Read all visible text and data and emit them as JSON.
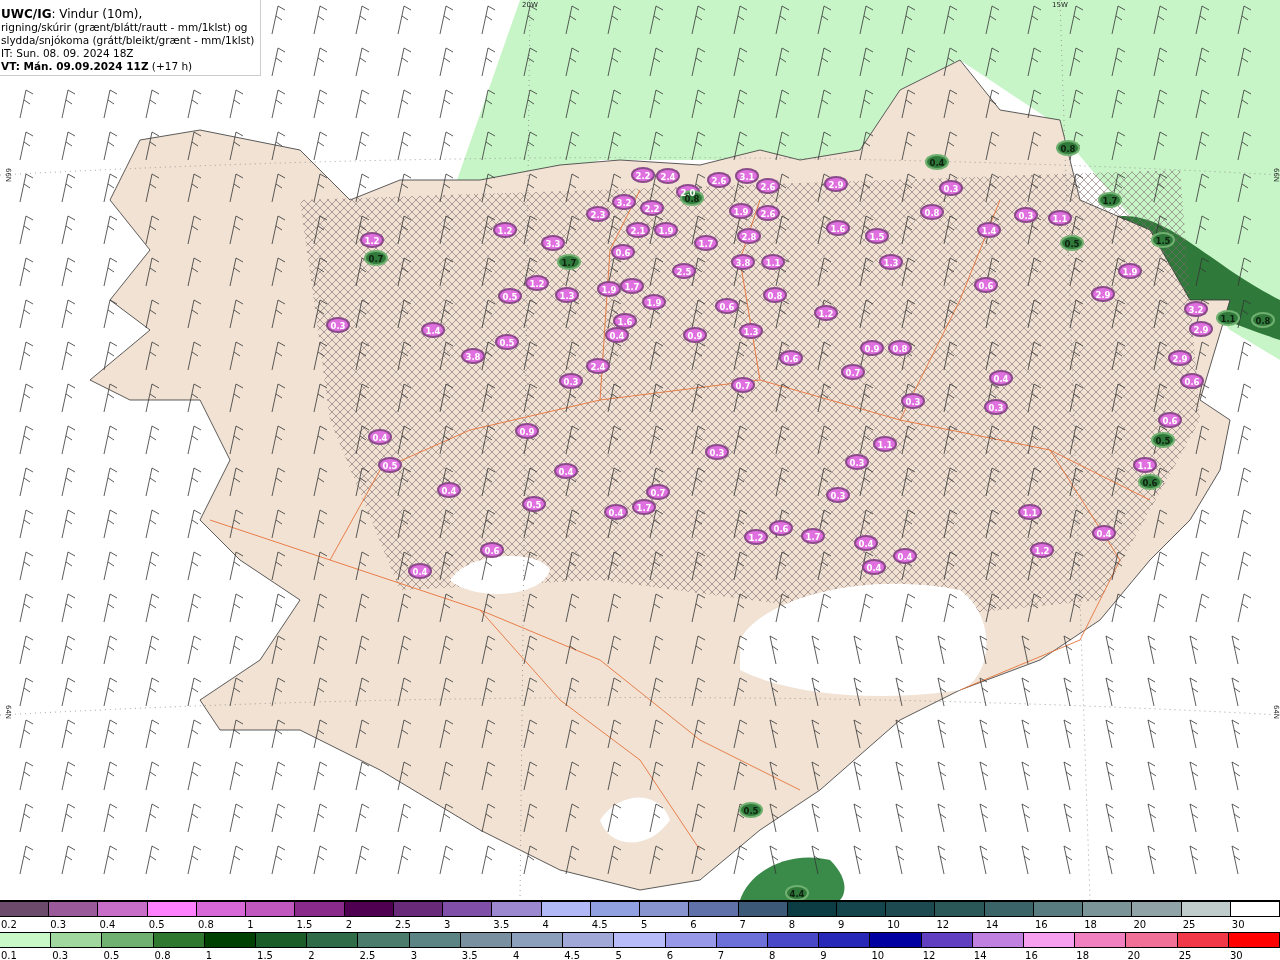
{
  "title_box": {
    "lines": [
      "**UWC/IG**: Vindur (10m),",
      "rigning/skúrir (grænt/blátt/rautt - mm/1klst) og",
      "slydda/snjókoma (grátt/bleikt/grænt - mm/1klst)",
      "IT: Sun. 08. 09. 2024 18Z",
      "**VT: Mán. 09.09.2024 11Z** (+17 h)"
    ]
  },
  "map": {
    "grid_labels": [
      "20W",
      "15W",
      "66N",
      "66N",
      "64N",
      "64N"
    ],
    "labels": [
      {
        "text": "1.2",
        "kind": "snow"
      },
      {
        "text": "0.7",
        "kind": "rain"
      },
      {
        "text": "0.3",
        "kind": "snow"
      },
      {
        "text": "1.4",
        "kind": "snow"
      },
      {
        "text": "0.5",
        "kind": "snow"
      },
      {
        "text": "3.8",
        "kind": "snow"
      },
      {
        "text": "1.2",
        "kind": "snow"
      },
      {
        "text": "3.3",
        "kind": "snow"
      },
      {
        "text": "1.7",
        "kind": "rain"
      },
      {
        "text": "1.2",
        "kind": "snow"
      },
      {
        "text": "0.5",
        "kind": "snow"
      },
      {
        "text": "1.3",
        "kind": "snow"
      },
      {
        "text": "2.4",
        "kind": "snow"
      },
      {
        "text": "0.3",
        "kind": "snow"
      },
      {
        "text": "0.4",
        "kind": "snow"
      },
      {
        "text": "1.9",
        "kind": "snow"
      },
      {
        "text": "1.7",
        "kind": "snow"
      },
      {
        "text": "1.9",
        "kind": "snow"
      },
      {
        "text": "1.6",
        "kind": "snow"
      },
      {
        "text": "2.3",
        "kind": "snow"
      },
      {
        "text": "3.2",
        "kind": "snow"
      },
      {
        "text": "2.2",
        "kind": "snow"
      },
      {
        "text": "2.4",
        "kind": "snow"
      },
      {
        "text": "2.2",
        "kind": "snow"
      },
      {
        "text": "2.0",
        "kind": "snow"
      },
      {
        "text": "0.8",
        "kind": "rain"
      },
      {
        "text": "2.1",
        "kind": "snow"
      },
      {
        "text": "1.9",
        "kind": "snow"
      },
      {
        "text": "0.6",
        "kind": "snow"
      },
      {
        "text": "1.7",
        "kind": "snow"
      },
      {
        "text": "2.5",
        "kind": "snow"
      },
      {
        "text": "2.6",
        "kind": "snow"
      },
      {
        "text": "3.1",
        "kind": "snow"
      },
      {
        "text": "2.6",
        "kind": "snow"
      },
      {
        "text": "1.9",
        "kind": "snow"
      },
      {
        "text": "2.6",
        "kind": "snow"
      },
      {
        "text": "2.8",
        "kind": "snow"
      },
      {
        "text": "3.8",
        "kind": "snow"
      },
      {
        "text": "1.1",
        "kind": "snow"
      },
      {
        "text": "0.8",
        "kind": "snow"
      },
      {
        "text": "0.6",
        "kind": "snow"
      },
      {
        "text": "0.9",
        "kind": "snow"
      },
      {
        "text": "1.3",
        "kind": "snow"
      },
      {
        "text": "0.6",
        "kind": "snow"
      },
      {
        "text": "0.7",
        "kind": "snow"
      },
      {
        "text": "2.9",
        "kind": "snow"
      },
      {
        "text": "1.6",
        "kind": "snow"
      },
      {
        "text": "1.5",
        "kind": "snow"
      },
      {
        "text": "1.3",
        "kind": "snow"
      },
      {
        "text": "1.2",
        "kind": "snow"
      },
      {
        "text": "0.7",
        "kind": "snow"
      },
      {
        "text": "0.9",
        "kind": "snow"
      },
      {
        "text": "0.8",
        "kind": "snow"
      },
      {
        "text": "0.3",
        "kind": "snow"
      },
      {
        "text": "0.8",
        "kind": "snow"
      },
      {
        "text": "0.3",
        "kind": "snow"
      },
      {
        "text": "0.4",
        "kind": "rain"
      },
      {
        "text": "1.4",
        "kind": "snow"
      },
      {
        "text": "0.6",
        "kind": "snow"
      },
      {
        "text": "0.3",
        "kind": "snow"
      },
      {
        "text": "1.1",
        "kind": "snow"
      },
      {
        "text": "0.5",
        "kind": "rain"
      },
      {
        "text": "0.4",
        "kind": "snow"
      },
      {
        "text": "0.3",
        "kind": "snow"
      },
      {
        "text": "1.5",
        "kind": "rain"
      },
      {
        "text": "1.9",
        "kind": "snow"
      },
      {
        "text": "2.9",
        "kind": "snow"
      },
      {
        "text": "3.2",
        "kind": "snow"
      },
      {
        "text": "2.9",
        "kind": "snow"
      },
      {
        "text": "2.9",
        "kind": "snow"
      },
      {
        "text": "0.6",
        "kind": "snow"
      },
      {
        "text": "0.6",
        "kind": "snow"
      },
      {
        "text": "0.5",
        "kind": "rain"
      },
      {
        "text": "1.1",
        "kind": "snow"
      },
      {
        "text": "0.6",
        "kind": "rain"
      },
      {
        "text": "0.8",
        "kind": "rain"
      },
      {
        "text": "1.7",
        "kind": "rain"
      },
      {
        "text": "1.1",
        "kind": "rain"
      },
      {
        "text": "0.8",
        "kind": "rain"
      },
      {
        "text": "0.4",
        "kind": "snow"
      },
      {
        "text": "0.5",
        "kind": "snow"
      },
      {
        "text": "0.4",
        "kind": "snow"
      },
      {
        "text": "0.9",
        "kind": "snow"
      },
      {
        "text": "0.4",
        "kind": "snow"
      },
      {
        "text": "0.5",
        "kind": "snow"
      },
      {
        "text": "0.6",
        "kind": "snow"
      },
      {
        "text": "0.4",
        "kind": "snow"
      },
      {
        "text": "0.4",
        "kind": "snow"
      },
      {
        "text": "0.7",
        "kind": "snow"
      },
      {
        "text": "1.7",
        "kind": "snow"
      },
      {
        "text": "0.3",
        "kind": "snow"
      },
      {
        "text": "1.1",
        "kind": "snow"
      },
      {
        "text": "0.3",
        "kind": "snow"
      },
      {
        "text": "0.3",
        "kind": "snow"
      },
      {
        "text": "1.2",
        "kind": "snow"
      },
      {
        "text": "0.6",
        "kind": "snow"
      },
      {
        "text": "1.7",
        "kind": "snow"
      },
      {
        "text": "0.4",
        "kind": "snow"
      },
      {
        "text": "0.4",
        "kind": "snow"
      },
      {
        "text": "0.4",
        "kind": "snow"
      },
      {
        "text": "1.1",
        "kind": "snow"
      },
      {
        "text": "1.2",
        "kind": "snow"
      },
      {
        "text": "0.4",
        "kind": "snow"
      },
      {
        "text": "0.5",
        "kind": "rain"
      },
      {
        "text": "4.4",
        "kind": "rain"
      }
    ]
  },
  "legends": [
    {
      "items": [
        {
          "label": "0.2",
          "color": "#6b4a6b"
        },
        {
          "label": "0.3",
          "color": "#9a5a9a"
        },
        {
          "label": "0.4",
          "color": "#c86ec8"
        },
        {
          "label": "0.5",
          "color": "#ff80ff"
        },
        {
          "label": "0.8",
          "color": "#d868d8"
        },
        {
          "label": "1",
          "color": "#c058c0"
        },
        {
          "label": "1.5",
          "color": "#8a2a8a"
        },
        {
          "label": "2",
          "color": "#500050"
        },
        {
          "label": "2.5",
          "color": "#6a2a7a"
        },
        {
          "label": "3",
          "color": "#8050a8"
        },
        {
          "label": "3.5",
          "color": "#9c88d0"
        },
        {
          "label": "4",
          "color": "#b0b8f8"
        },
        {
          "label": "4.5",
          "color": "#90a0e0"
        },
        {
          "label": "5",
          "color": "#8894d0"
        },
        {
          "label": "6",
          "color": "#6070a8"
        },
        {
          "label": "7",
          "color": "#3c5a78"
        },
        {
          "label": "8",
          "color": "#0c3c44"
        },
        {
          "label": "9",
          "color": "#14444c"
        },
        {
          "label": "10",
          "color": "#1c4a50"
        },
        {
          "label": "12",
          "color": "#2a5858"
        },
        {
          "label": "14",
          "color": "#3a6468"
        },
        {
          "label": "16",
          "color": "#587c80"
        },
        {
          "label": "18",
          "color": "#7a9498"
        },
        {
          "label": "20",
          "color": "#90a4a8"
        },
        {
          "label": "25",
          "color": "#c0cccc"
        },
        {
          "label": "30",
          "color": "#ffffff"
        }
      ]
    },
    {
      "items": [
        {
          "label": "0.1",
          "color": "#c8f8c8"
        },
        {
          "label": "0.3",
          "color": "#a0d8a0"
        },
        {
          "label": "0.5",
          "color": "#70b070"
        },
        {
          "label": "0.8",
          "color": "#307830"
        },
        {
          "label": "1",
          "color": "#004000"
        },
        {
          "label": "1.5",
          "color": "#1c5c28"
        },
        {
          "label": "2",
          "color": "#306c48"
        },
        {
          "label": "2.5",
          "color": "#4c7c6c"
        },
        {
          "label": "3",
          "color": "#5c8484"
        },
        {
          "label": "3.5",
          "color": "#7890a0"
        },
        {
          "label": "4",
          "color": "#8ca0bc"
        },
        {
          "label": "4.5",
          "color": "#a0a8d8"
        },
        {
          "label": "5",
          "color": "#b8bcf8"
        },
        {
          "label": "6",
          "color": "#9898e8"
        },
        {
          "label": "7",
          "color": "#6c70d8"
        },
        {
          "label": "8",
          "color": "#4848c8"
        },
        {
          "label": "9",
          "color": "#2828b8"
        },
        {
          "label": "10",
          "color": "#0000a0"
        },
        {
          "label": "12",
          "color": "#6040c0"
        },
        {
          "label": "14",
          "color": "#c080e0"
        },
        {
          "label": "16",
          "color": "#f8a0f0"
        },
        {
          "label": "18",
          "color": "#f080c0"
        },
        {
          "label": "20",
          "color": "#f07098"
        },
        {
          "label": "25",
          "color": "#f03848"
        },
        {
          "label": "30",
          "color": "#ff0000"
        }
      ]
    }
  ]
}
